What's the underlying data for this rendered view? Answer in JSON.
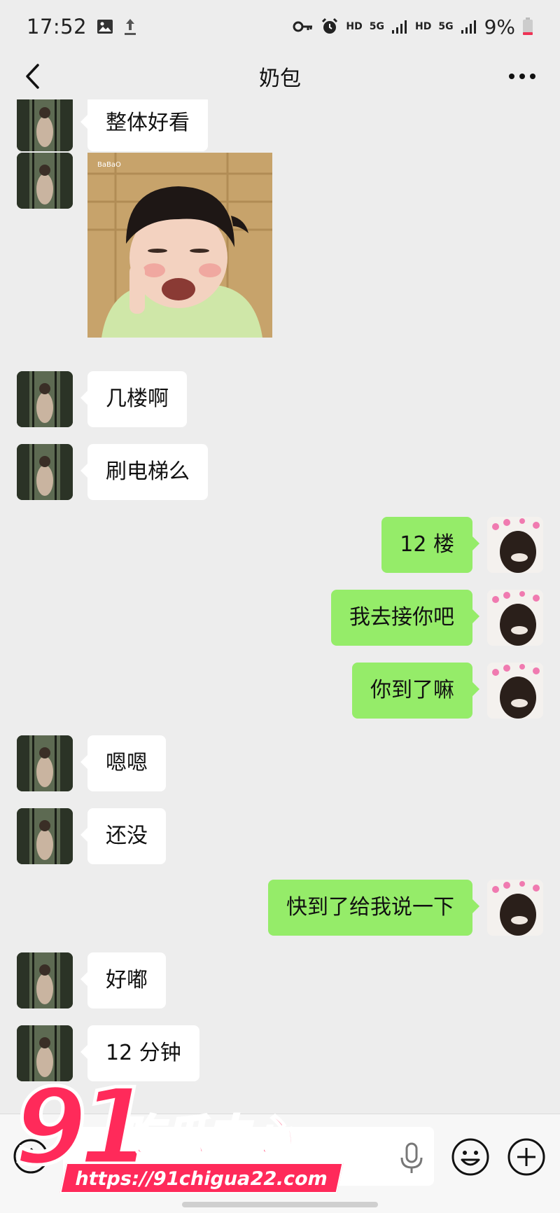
{
  "status_bar": {
    "time": "17:52",
    "network_labels": [
      "HD",
      "5G",
      "HD",
      "5G"
    ],
    "battery": "9%"
  },
  "header": {
    "title": "奶包"
  },
  "messages": [
    {
      "from": "other",
      "kind": "text",
      "text": "整体好看"
    },
    {
      "from": "other",
      "kind": "sticker",
      "sticker_label": "BaBaO"
    },
    {
      "from": "other",
      "kind": "text",
      "text": "几楼啊"
    },
    {
      "from": "other",
      "kind": "text",
      "text": "刷电梯么"
    },
    {
      "from": "self",
      "kind": "text",
      "text": "12 楼"
    },
    {
      "from": "self",
      "kind": "text",
      "text": "我去接你吧"
    },
    {
      "from": "self",
      "kind": "text",
      "text": "你到了嘛"
    },
    {
      "from": "other",
      "kind": "text",
      "text": "嗯嗯"
    },
    {
      "from": "other",
      "kind": "text",
      "text": "还没"
    },
    {
      "from": "self",
      "kind": "text",
      "text": "快到了给我说一下"
    },
    {
      "from": "other",
      "kind": "text",
      "text": "好嘟"
    },
    {
      "from": "other",
      "kind": "text",
      "text": "12 分钟"
    }
  ],
  "input_bar": {
    "value": "",
    "icons": [
      "voice-icon",
      "microphone-icon",
      "emoji-icon",
      "plus-icon"
    ]
  },
  "watermark": {
    "number": "91",
    "brand": "吃瓜中心",
    "url": "https://91chigua22.com"
  },
  "colors": {
    "background": "#ededed",
    "self_bubble": "#95ec69",
    "other_bubble": "#ffffff",
    "watermark": "#ff2a5a"
  }
}
